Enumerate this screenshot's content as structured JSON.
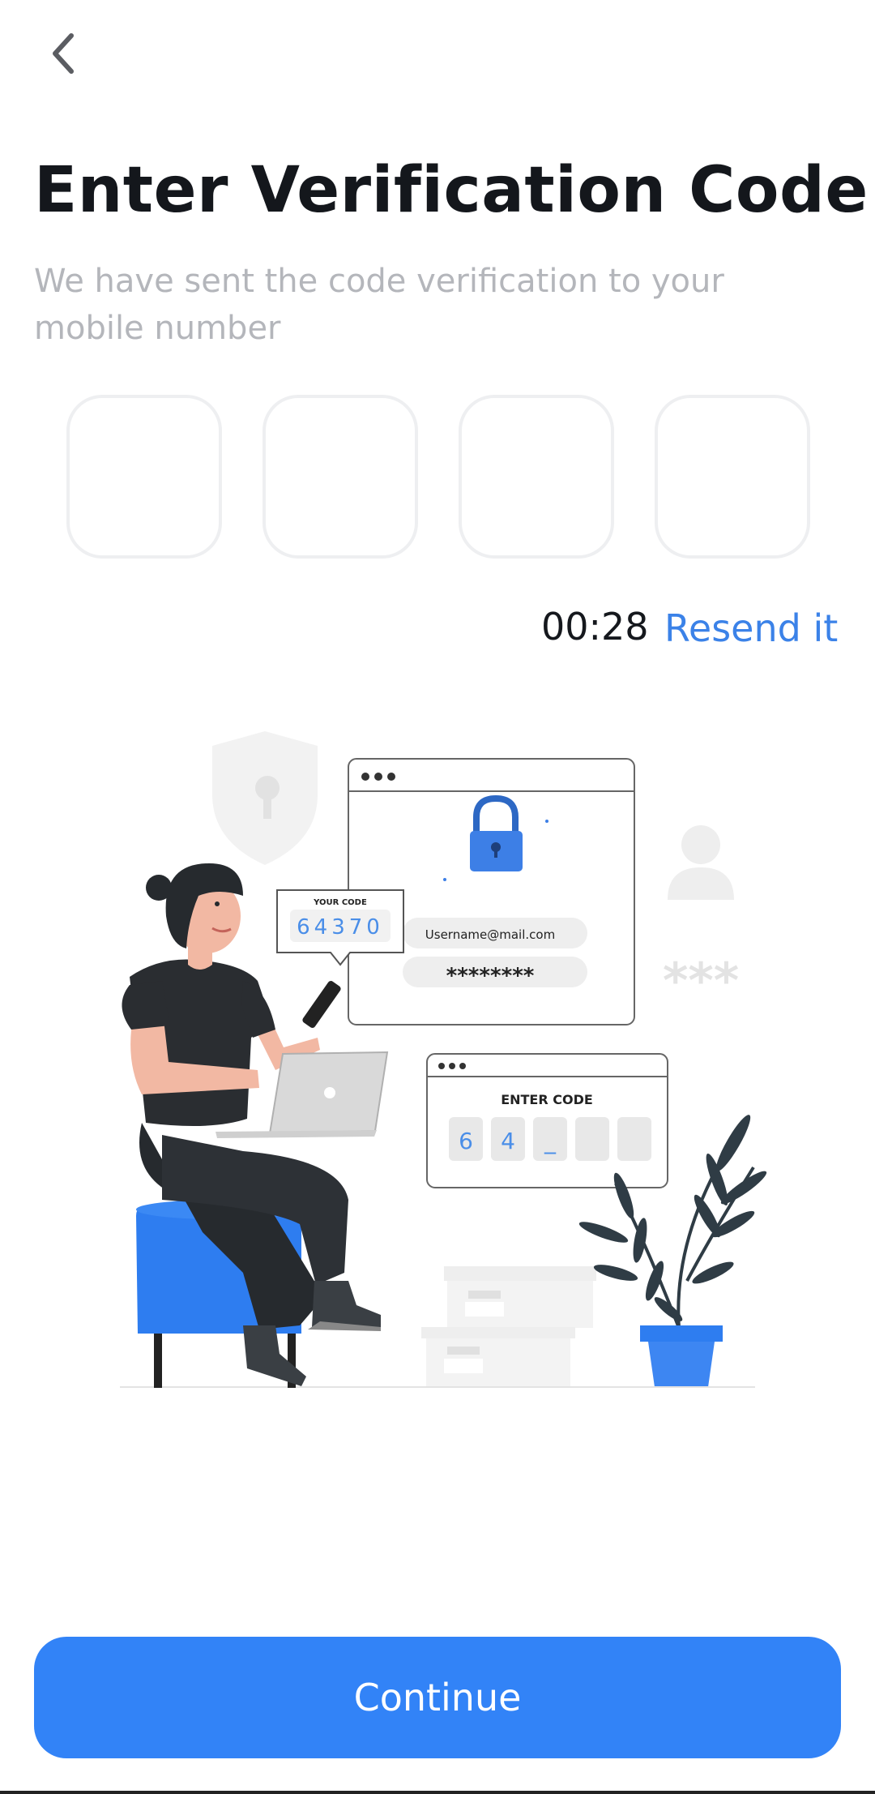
{
  "header": {
    "back_icon": "chevron-left-icon"
  },
  "title": "Enter Verification Code",
  "subtitle": "We have sent the code verification to your mobile number",
  "otp": {
    "digits": [
      "",
      "",
      "",
      ""
    ]
  },
  "timer": "00:28",
  "resend_label": "Resend it",
  "illustration": {
    "bubble_title": "YOUR CODE",
    "bubble_code": "64370",
    "username": "Username@mail.com",
    "password_mask": "********",
    "stars": "***",
    "enter_code_title": "ENTER CODE",
    "code_cells": [
      "6",
      "4",
      "_",
      "",
      ""
    ]
  },
  "continue_label": "Continue",
  "colors": {
    "accent": "#3283f7",
    "link": "#3b82e8",
    "title": "#14171c",
    "subtitle": "#b4b6bb"
  }
}
